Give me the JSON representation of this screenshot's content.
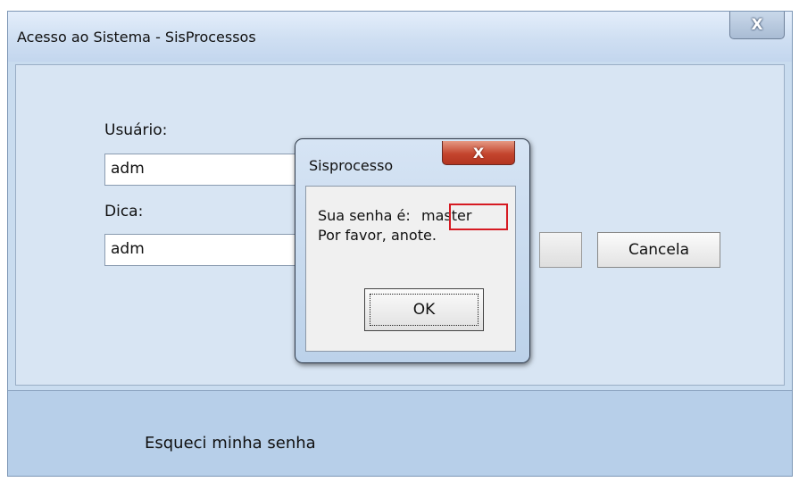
{
  "window": {
    "title": "Acesso ao Sistema - SisProcessos",
    "close_glyph": "X"
  },
  "form": {
    "user_label": "Usuário:",
    "user_value": "adm",
    "hint_label": "Dica:",
    "hint_value": "adm",
    "cancel_label": "Cancela"
  },
  "footer": {
    "forgot_link": "Esqueci minha senha"
  },
  "dialog": {
    "title": "Sisprocesso",
    "close_glyph": "X",
    "message_prefix": "Sua senha é:",
    "password": "master",
    "message_line2": "Por favor, anote.",
    "ok_label": "OK",
    "highlight_color": "#d61a22"
  }
}
